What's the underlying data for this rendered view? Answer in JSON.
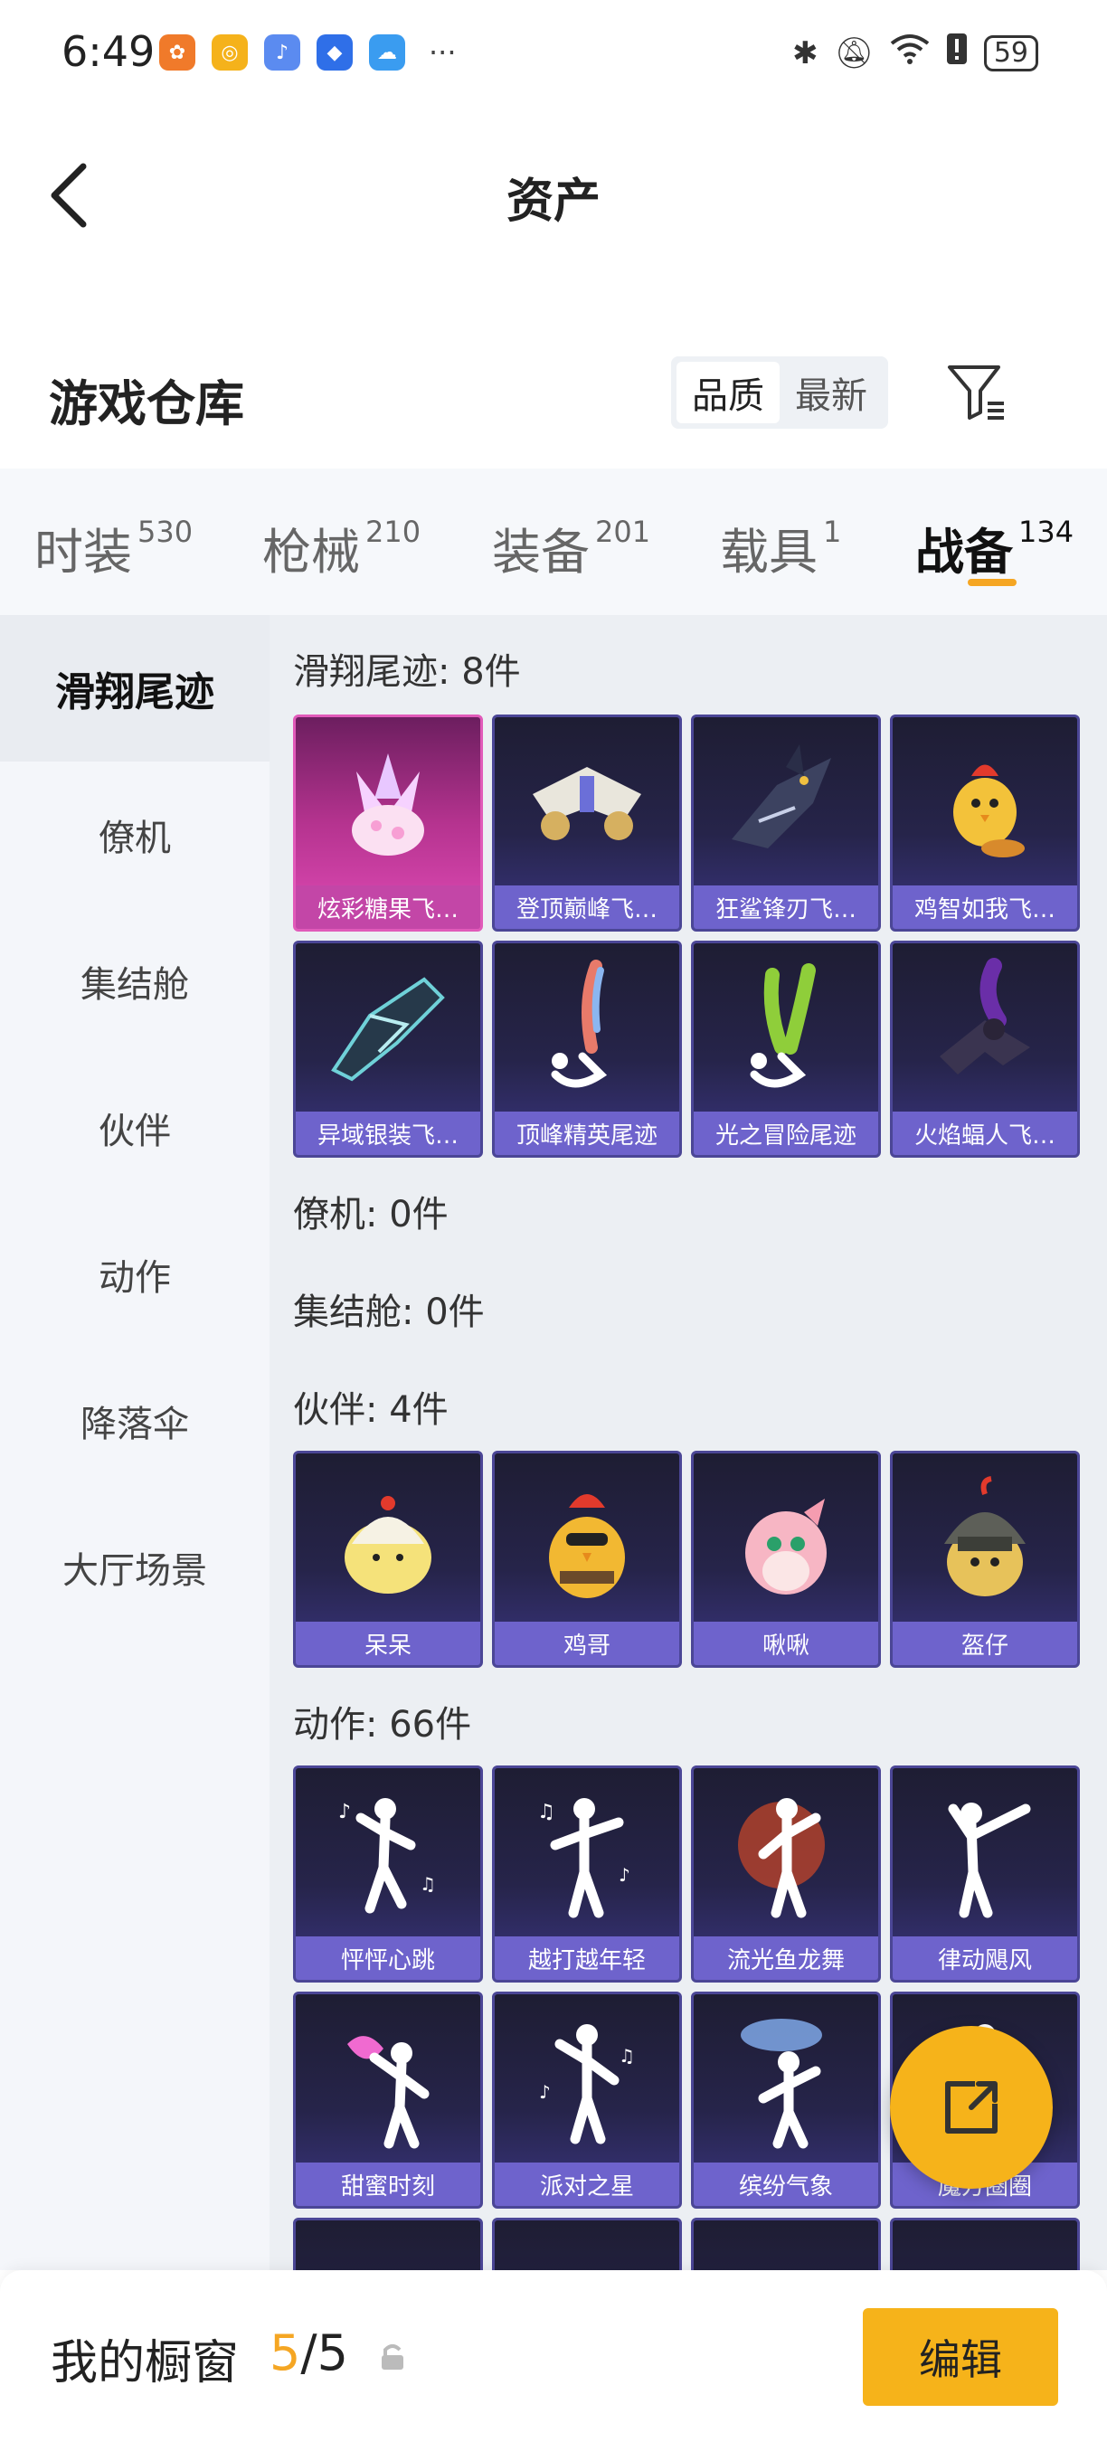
{
  "status_bar": {
    "time": "6:49",
    "battery": "59",
    "app_icons": [
      "app-icon-1",
      "app-icon-2",
      "app-icon-3",
      "app-icon-4",
      "app-icon-5"
    ],
    "more": "···"
  },
  "header": {
    "title": "资产"
  },
  "section": {
    "title": "游戏仓库",
    "sort_options": [
      "品质",
      "最新"
    ],
    "active_sort": "品质"
  },
  "category_tabs": [
    {
      "label": "时装",
      "count": "530"
    },
    {
      "label": "枪械",
      "count": "210"
    },
    {
      "label": "装备",
      "count": "201"
    },
    {
      "label": "载具",
      "count": "1"
    },
    {
      "label": "战备",
      "count": "134"
    }
  ],
  "active_tab": "战备",
  "sidebar": [
    {
      "label": "滑翔尾迹"
    },
    {
      "label": "僚机"
    },
    {
      "label": "集结舱"
    },
    {
      "label": "伙伴"
    },
    {
      "label": "动作"
    },
    {
      "label": "降落伞"
    },
    {
      "label": "大厅场景"
    }
  ],
  "groups": [
    {
      "label": "滑翔尾迹: 8件",
      "items": [
        {
          "name": "炫彩糖果飞…",
          "art": "candy-glider-icon"
        },
        {
          "name": "登顶巅峰飞…",
          "art": "jet-glider-icon"
        },
        {
          "name": "狂鲨锋刃飞…",
          "art": "shark-glider-icon"
        },
        {
          "name": "鸡智如我飞…",
          "art": "chicken-glider-icon"
        },
        {
          "name": "异域银装飞…",
          "art": "exotic-glider-icon"
        },
        {
          "name": "顶峰精英尾迹",
          "art": "elite-trail-icon"
        },
        {
          "name": "光之冒险尾迹",
          "art": "light-trail-icon"
        },
        {
          "name": "火焰蝠人飞…",
          "art": "batman-glider-icon"
        }
      ]
    },
    {
      "label": "僚机: 0件",
      "items": []
    },
    {
      "label": "集结舱: 0件",
      "items": []
    },
    {
      "label": "伙伴: 4件",
      "items": [
        {
          "name": "呆呆",
          "art": "chick-icon"
        },
        {
          "name": "鸡哥",
          "art": "rooster-icon"
        },
        {
          "name": "啾啾",
          "art": "pink-bird-icon"
        },
        {
          "name": "盔仔",
          "art": "helmet-chick-icon"
        }
      ]
    },
    {
      "label": "动作: 66件",
      "items": [
        {
          "name": "怦怦心跳",
          "art": "dance-icon"
        },
        {
          "name": "越打越年轻",
          "art": "dance-icon"
        },
        {
          "name": "流光鱼龙舞",
          "art": "dance-icon"
        },
        {
          "name": "律动飓风",
          "art": "dance-icon"
        },
        {
          "name": "甜蜜时刻",
          "art": "dance-icon"
        },
        {
          "name": "派对之星",
          "art": "dance-icon"
        },
        {
          "name": "缤纷气象",
          "art": "dance-icon"
        },
        {
          "name": "魔方圈圈",
          "art": "dance-icon"
        }
      ]
    }
  ],
  "bottom_bar": {
    "title": "我的橱窗",
    "current": "5",
    "separator": "/",
    "total": "5",
    "edit_label": "编辑"
  },
  "colors": {
    "accent": "#f6b31a",
    "card_label": "#6e63cc",
    "card_bg": "#26244a"
  }
}
